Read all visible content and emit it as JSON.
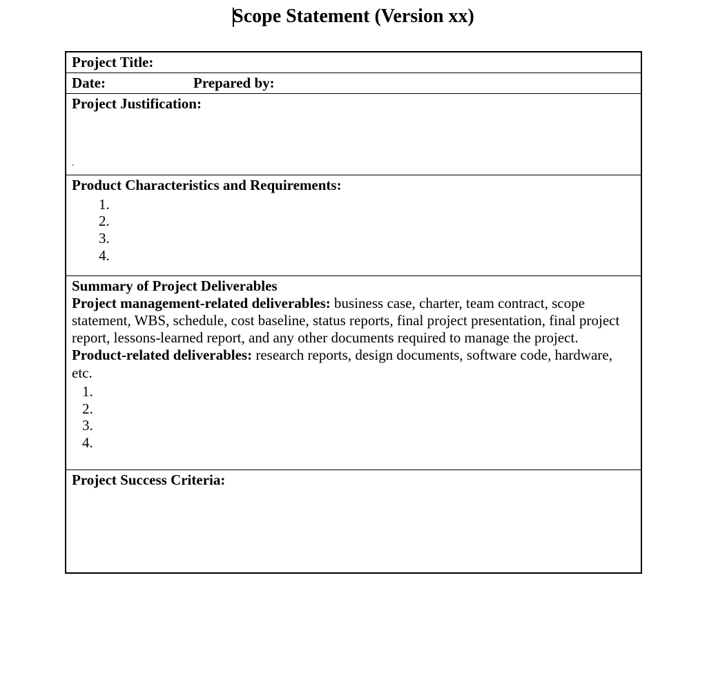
{
  "title": "Scope Statement (Version xx)",
  "rows": {
    "project_title_label": "Project Title:",
    "date_label": "Date:",
    "prepared_by_label": "Prepared by:",
    "justification_label": "Project Justification:",
    "characteristics_label": "Product Characteristics and Requirements:",
    "characteristics_items": [
      "",
      "",
      "",
      ""
    ],
    "summary_heading": "Summary of Project Deliverables",
    "pm_deliverables_label": "Project management-related deliverables:",
    "pm_deliverables_text": " business case, charter, team contract, scope statement, WBS, schedule, cost baseline, status reports, final project presentation, final project report, lessons-learned report, and any other documents required to manage the project.",
    "product_deliverables_label": "Product-related deliverables:",
    "product_deliverables_text": " research reports, design documents, software code, hardware, etc.",
    "product_deliverables_items": [
      "",
      "",
      "",
      ""
    ],
    "success_label": "Project Success Criteria:"
  }
}
